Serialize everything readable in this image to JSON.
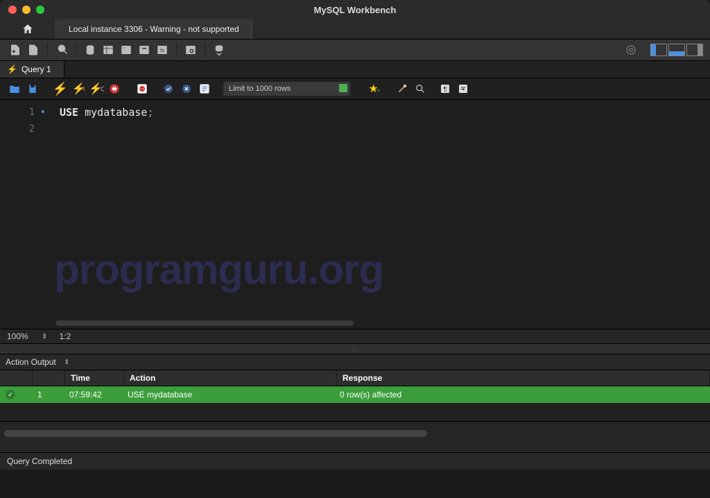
{
  "window": {
    "title": "MySQL Workbench"
  },
  "connection_tab": {
    "label": "Local instance 3306 - Warning - not supported"
  },
  "query_tab": {
    "label": "Query 1"
  },
  "limit_select": {
    "value": "Limit to 1000 rows"
  },
  "code": {
    "line1_keyword": "USE",
    "line1_ident": " mydatabase",
    "line1_punct": ";"
  },
  "gutter": {
    "l1": "1",
    "l2": "2"
  },
  "status": {
    "zoom": "100%",
    "cursor": "1:2"
  },
  "output": {
    "dropdown": "Action Output",
    "columns": {
      "time": "Time",
      "action": "Action",
      "response": "Response"
    },
    "rows": [
      {
        "idx": "1",
        "time": "07:59:42",
        "action": "USE mydatabase",
        "response": "0 row(s) affected"
      }
    ]
  },
  "footer": {
    "status": "Query Completed"
  },
  "watermark": "programguru.org"
}
